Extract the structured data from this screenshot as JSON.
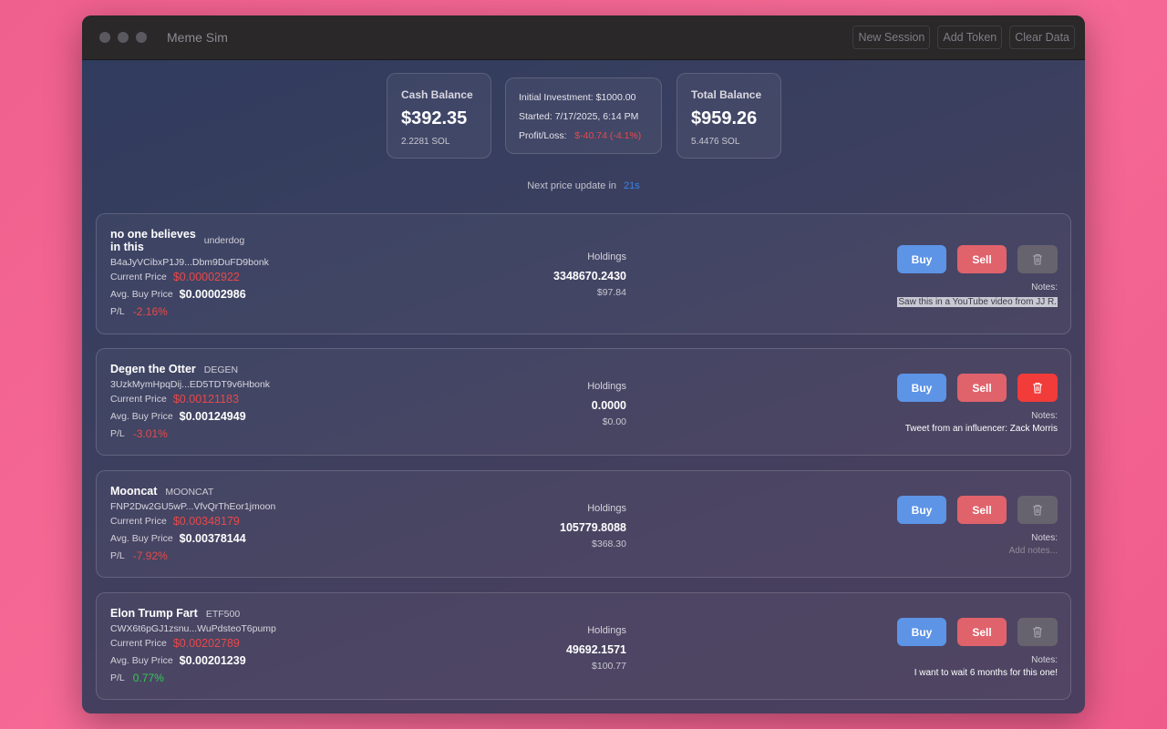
{
  "window": {
    "title": "Meme Sim",
    "actions": [
      "New Session",
      "Add Token",
      "Clear Data"
    ]
  },
  "summary": {
    "cash": {
      "title": "Cash Balance",
      "amount": "$392.35",
      "sol": "2.2281 SOL"
    },
    "info": {
      "initial_label": "Initial Investment:",
      "initial_value": "$1000.00",
      "started_label": "Started:",
      "started_value": "7/17/2025, 6:14 PM",
      "pl_label": "Profit/Loss:",
      "pl_value": "$-40.74 (-4.1%)"
    },
    "total": {
      "title": "Total Balance",
      "amount": "$959.26",
      "sol": "5.4476 SOL"
    }
  },
  "price_update": {
    "label": "Next price update in",
    "seconds": "21s"
  },
  "labels": {
    "current_price": "Current Price",
    "avg_buy_price": "Avg. Buy Price",
    "pl": "P/L",
    "holdings": "Holdings",
    "notes": "Notes:",
    "buy": "Buy",
    "sell": "Sell"
  },
  "tokens": [
    {
      "name_line1": "no one believes",
      "name_line2": "in this",
      "symbol": "underdog",
      "address": "B4aJyVCibxP1J9...Dbm9DuFD9bonk",
      "current_price": "$0.00002922",
      "avg_buy_price": "$0.00002986",
      "pl": "-2.16%",
      "holdings": "3348670.2430",
      "holdings_usd": "$97.84",
      "notes": "Saw this in a YouTube video from JJ R."
    },
    {
      "name": "Degen the Otter",
      "symbol": "DEGEN",
      "address": "3UzkMymHpqDij...ED5TDT9v6Hbonk",
      "current_price": "$0.00121183",
      "avg_buy_price": "$0.00124949",
      "pl": "-3.01%",
      "holdings": "0.0000",
      "holdings_usd": "$0.00",
      "notes": "Tweet from an influencer: Zack Morris"
    },
    {
      "name": "Mooncat",
      "symbol": "MOONCAT",
      "address": "FNP2Dw2GU5wP...VfvQrThEor1jmoon",
      "current_price": "$0.00348179",
      "avg_buy_price": "$0.00378144",
      "pl": "-7.92%",
      "holdings": "105779.8088",
      "holdings_usd": "$368.30",
      "notes_placeholder": "Add notes..."
    },
    {
      "name": "Elon Trump Fart",
      "symbol": "ETF500",
      "address": "CWX6t6pGJ1zsnu...WuPdsteoT6pump",
      "current_price": "$0.00202789",
      "avg_buy_price": "$0.00201239",
      "pl": "0.77%",
      "holdings": "49692.1571",
      "holdings_usd": "$100.77",
      "notes": "I want to wait 6 months for this one!"
    }
  ],
  "colors": {
    "negative": "#e8494a",
    "positive": "#34c759",
    "accent": "#3b82e6",
    "buy": "#5d94e6",
    "sell": "#e0636c",
    "delete_active": "#f13c3a"
  },
  "icons": {
    "delete": "trash-icon"
  }
}
